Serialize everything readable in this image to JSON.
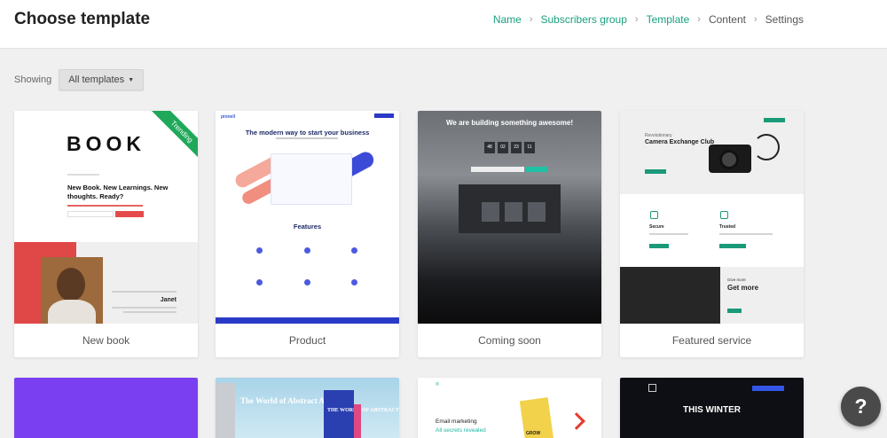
{
  "header": {
    "title": "Choose template",
    "breadcrumbs": [
      {
        "label": "Name"
      },
      {
        "label": "Subscribers group"
      },
      {
        "label": "Template"
      },
      {
        "label": "Content"
      },
      {
        "label": "Settings"
      }
    ]
  },
  "filter": {
    "label": "Showing",
    "selected": "All templates"
  },
  "templates": [
    {
      "label": "New book",
      "badge": "Trending",
      "preview": {
        "logo": "BOOK",
        "headline": "New Book. New Learnings. New thoughts. Ready?",
        "author_name": "Janet"
      }
    },
    {
      "label": "Product",
      "preview": {
        "brand": "pinnell",
        "headline": "The modern way to start your business",
        "section": "Features"
      }
    },
    {
      "label": "Coming soon",
      "preview": {
        "headline": "We are building something awesome!",
        "countdown": [
          "48",
          "02",
          "23",
          "11"
        ]
      }
    },
    {
      "label": "Featured service",
      "preview": {
        "headline": "Camera Exchange Club",
        "kicker": "Revolutionary",
        "features": [
          "Secure",
          "Trusted"
        ],
        "more_small": "Give more",
        "more": "Get more"
      }
    },
    {
      "label": "",
      "preview": {}
    },
    {
      "label": "",
      "preview": {
        "headline": "The World of Abstract Art",
        "cover": "THE WORLD OF ABSTRACT"
      }
    },
    {
      "label": "",
      "preview": {
        "headline": "Email marketing",
        "subheadline": "All secrets revealed",
        "book": "GROW"
      }
    },
    {
      "label": "",
      "preview": {
        "headline": "THIS WINTER"
      }
    }
  ],
  "help_button": {
    "label": "?"
  },
  "colors": {
    "accent": "#19a17f",
    "trending": "#1fa85a",
    "help_bg": "#4a4a4a"
  },
  "icons": {
    "breadcrumb_separator": "chevron-right-icon",
    "dropdown": "caret-down-icon",
    "help": "question-mark-icon"
  }
}
